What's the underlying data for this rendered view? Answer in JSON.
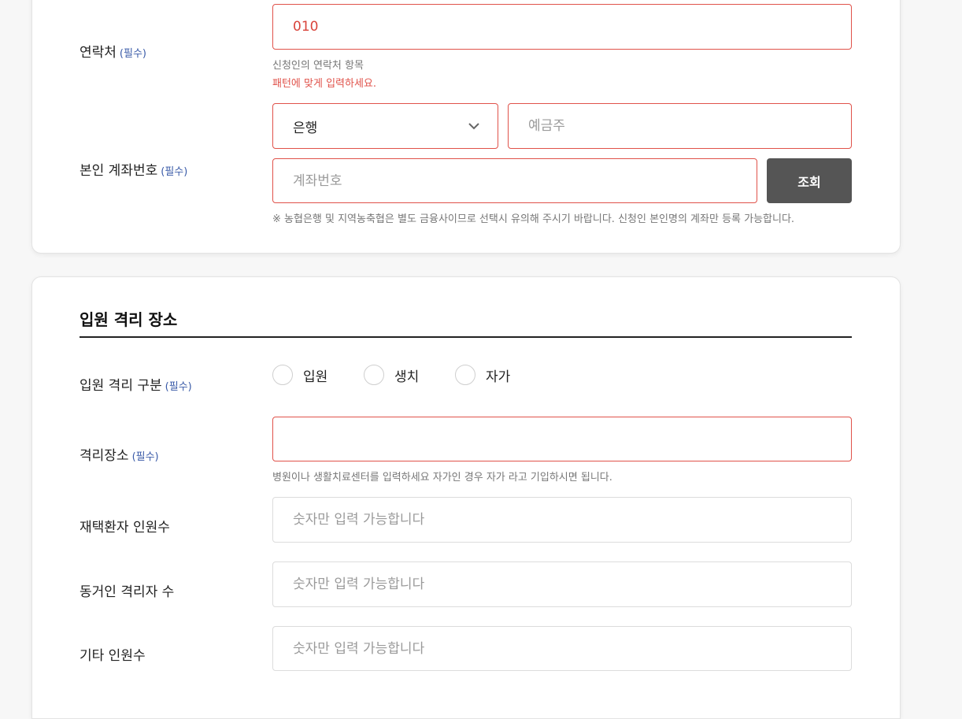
{
  "contact": {
    "label": "연락처",
    "required": "(필수)",
    "value": "010",
    "help": "신청인의 연락처 항목",
    "error": "패턴에 맞게 입력하세요."
  },
  "account": {
    "label": "본인 계좌번호",
    "required": "(필수)",
    "bank_selected": "은행",
    "holder_placeholder": "예금주",
    "number_placeholder": "계좌번호",
    "lookup_button": "조회",
    "notice": "※ 농협은행 및 지역농축협은 별도 금융사이므로 선택시 유의해 주시기 바랍니다. 신청인 본인명의 계좌만 등록 가능합니다."
  },
  "quarantine": {
    "section_title": "입원 격리 장소",
    "type_label": "입원 격리 구분",
    "type_required": "(필수)",
    "options": [
      "입원",
      "생치",
      "자가"
    ],
    "place_label": "격리장소",
    "place_required": "(필수)",
    "place_value": "",
    "place_help": "병원이나 생활치료센터를 입력하세요 자가인 경우 자가 라고 기입하시면 됩니다.",
    "home_patients_label": "재택환자 인원수",
    "cohabitants_label": "동거인 격리자 수",
    "others_label": "기타 인원수",
    "number_placeholder": "숫자만 입력 가능합니다"
  },
  "colors": {
    "error": "#e0524a",
    "required": "#3a5ba8",
    "button": "#555555"
  }
}
